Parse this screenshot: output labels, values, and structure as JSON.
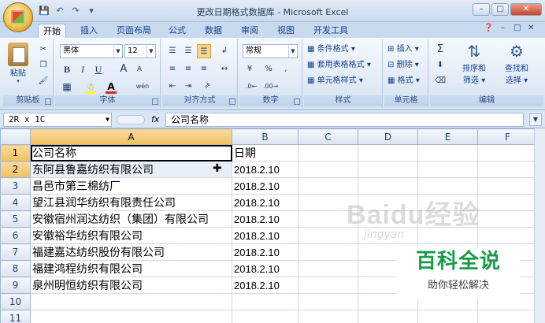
{
  "window": {
    "title": "更改日期格式数据库 - Microsoft Excel"
  },
  "qat": {
    "save_icon": "save-icon",
    "undo_icon": "undo-icon",
    "redo_icon": "redo-icon"
  },
  "tabs": [
    "开始",
    "插入",
    "页面布局",
    "公式",
    "数据",
    "审阅",
    "视图",
    "开发工具"
  ],
  "clipboard": {
    "paste_label": "粘贴",
    "group_label": "剪贴板"
  },
  "font": {
    "name": "黑体",
    "size": "12",
    "bold": "B",
    "italic": "I",
    "underline": "U",
    "grow": "A",
    "shrink": "A",
    "font_color_label": "A",
    "group_label": "字体",
    "phonetic": "wén"
  },
  "alignment": {
    "group_label": "对齐方式"
  },
  "number": {
    "format": "常规",
    "percent": "%",
    "comma": ",",
    "group_label": "数字"
  },
  "styles": {
    "conditional": "条件格式",
    "table": "套用表格格式",
    "cell": "单元格样式",
    "group_label": "样式"
  },
  "cells": {
    "insert": "插入",
    "delete": "删除",
    "format": "格式",
    "group_label": "单元格"
  },
  "editing": {
    "sum": "Σ",
    "sort": "排序和",
    "sort2": "筛选",
    "find": "查找和",
    "find2": "选择",
    "group_label": "编辑"
  },
  "formula_bar": {
    "name_box": "2R x 1C",
    "fx": "fx",
    "content": "公司名称"
  },
  "columns": [
    "A",
    "B",
    "C",
    "D",
    "E",
    "F"
  ],
  "rows": [
    {
      "num": "1",
      "a": "公司名称",
      "b": "日期"
    },
    {
      "num": "2",
      "a": "东阿县鲁嘉纺织有限公司",
      "b": "2018.2.10"
    },
    {
      "num": "3",
      "a": "昌邑市第三棉纺厂",
      "b": "2018.2.10"
    },
    {
      "num": "4",
      "a": "望江县润华纺织有限责任公司",
      "b": "2018.2.10"
    },
    {
      "num": "5",
      "a": "安徽宿州润达纺织（集团）有限公司",
      "b": "2018.2.10"
    },
    {
      "num": "6",
      "a": "安徽裕华纺织有限公司",
      "b": "2018.2.10"
    },
    {
      "num": "7",
      "a": "福建嘉达纺织股份有限公司",
      "b": "2018.2.10"
    },
    {
      "num": "8",
      "a": "福建鸿程纺织有限公司",
      "b": "2018.2.10"
    },
    {
      "num": "9",
      "a": "泉州明恒纺织有限公司",
      "b": "2018.2.10"
    },
    {
      "num": "10",
      "a": "",
      "b": ""
    },
    {
      "num": "11",
      "a": "",
      "b": ""
    }
  ],
  "watermark": {
    "text": "Baidu经验",
    "sub": "jingyan"
  },
  "brand": {
    "title": "百科全说",
    "subtitle": "助你轻松解决"
  },
  "colors": {
    "accent": "#15428b",
    "selected_header": "#f1c15f",
    "brand_green": "#1a9b4a"
  }
}
